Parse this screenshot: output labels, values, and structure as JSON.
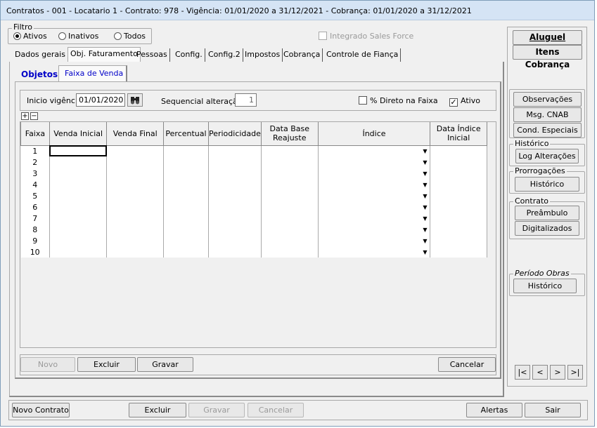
{
  "window": {
    "title": "Contratos - 001 - Locatario 1 - Contrato: 978 - Vigência: 01/01/2020 a 31/12/2021 - Cobrança: 01/01/2020 a 31/12/2021"
  },
  "filter": {
    "label": "Filtro",
    "options": [
      "Ativos",
      "Inativos",
      "Todos"
    ],
    "selected": "Ativos"
  },
  "sales_force": {
    "label": "Integrado Sales Force",
    "checked": false
  },
  "tabs": [
    "Dados gerais",
    "Obj. Faturamento",
    "Pessoas",
    "Config.",
    "Config.2",
    "Impostos",
    "Cobrança",
    "Controle de Fiança"
  ],
  "subtabs": [
    "Objetos",
    "Faixa de Venda"
  ],
  "form": {
    "inicio_label": "Inicio vigência",
    "inicio_value": "01/01/2020",
    "seq_label": "Sequencial alteração",
    "seq_value": "1",
    "direto_label": "% Direto na Faixa",
    "direto_checked": false,
    "ativo_label": "Ativo",
    "ativo_checked": true,
    "plus": "+",
    "minus": "−"
  },
  "grid": {
    "columns": [
      "Faixa",
      "Venda Inicial",
      "Venda Final",
      "Percentual",
      "Periodicidade",
      "Data Base Reajuste",
      "Índice",
      "Data Índice Inicial"
    ],
    "rows": [
      "1",
      "2",
      "3",
      "4",
      "5",
      "6",
      "7",
      "8",
      "9",
      "10"
    ]
  },
  "bottom_inner": {
    "novo": "Novo",
    "excluir": "Excluir",
    "gravar": "Gravar",
    "cancelar": "Cancelar"
  },
  "bottom": {
    "novo_contrato": "Novo Contrato",
    "excluir": "Excluir",
    "gravar": "Gravar",
    "cancelar": "Cancelar",
    "alertas": "Alertas",
    "sair": "Sair"
  },
  "right": {
    "aluguel": "Aluguel",
    "itens_cobranca": "Itens Cobrança",
    "observacoes": "Observações",
    "msg_cnab": "Msg. CNAB",
    "cond_especiais": "Cond. Especiais",
    "historico_label": "Histórico",
    "log_alteracoes": "Log Alterações",
    "prorrogacoes_label": "Prorrogações",
    "prorrogacoes_historico": "Histórico",
    "contrato_label": "Contrato",
    "preambulo": "Preâmbulo",
    "digitalizados": "Digitalizados",
    "periodo_obras_label": "Período Obras",
    "periodo_historico": "Histórico"
  },
  "nav": [
    "|<",
    "<",
    ">",
    ">|"
  ]
}
